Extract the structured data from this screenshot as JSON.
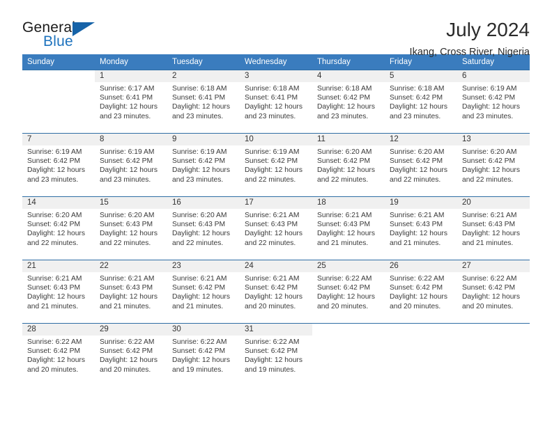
{
  "brand": {
    "name_part1": "General",
    "name_part2": "Blue",
    "logo_icon": "triangle-logo-icon"
  },
  "header": {
    "month_title": "July 2024",
    "location": "Ikang, Cross River, Nigeria"
  },
  "calendar": {
    "weekday_headers": [
      "Sunday",
      "Monday",
      "Tuesday",
      "Wednesday",
      "Thursday",
      "Friday",
      "Saturday"
    ],
    "accent_color": "#3a7cbe",
    "border_color": "#2e6da4",
    "daynum_bg": "#f0f0f0",
    "weeks": [
      [
        {
          "day": "",
          "blank": true,
          "lines": []
        },
        {
          "day": "1",
          "lines": [
            "Sunrise: 6:17 AM",
            "Sunset: 6:41 PM",
            "Daylight: 12 hours",
            "and 23 minutes."
          ]
        },
        {
          "day": "2",
          "lines": [
            "Sunrise: 6:18 AM",
            "Sunset: 6:41 PM",
            "Daylight: 12 hours",
            "and 23 minutes."
          ]
        },
        {
          "day": "3",
          "lines": [
            "Sunrise: 6:18 AM",
            "Sunset: 6:41 PM",
            "Daylight: 12 hours",
            "and 23 minutes."
          ]
        },
        {
          "day": "4",
          "lines": [
            "Sunrise: 6:18 AM",
            "Sunset: 6:42 PM",
            "Daylight: 12 hours",
            "and 23 minutes."
          ]
        },
        {
          "day": "5",
          "lines": [
            "Sunrise: 6:18 AM",
            "Sunset: 6:42 PM",
            "Daylight: 12 hours",
            "and 23 minutes."
          ]
        },
        {
          "day": "6",
          "lines": [
            "Sunrise: 6:19 AM",
            "Sunset: 6:42 PM",
            "Daylight: 12 hours",
            "and 23 minutes."
          ]
        }
      ],
      [
        {
          "day": "7",
          "lines": [
            "Sunrise: 6:19 AM",
            "Sunset: 6:42 PM",
            "Daylight: 12 hours",
            "and 23 minutes."
          ]
        },
        {
          "day": "8",
          "lines": [
            "Sunrise: 6:19 AM",
            "Sunset: 6:42 PM",
            "Daylight: 12 hours",
            "and 23 minutes."
          ]
        },
        {
          "day": "9",
          "lines": [
            "Sunrise: 6:19 AM",
            "Sunset: 6:42 PM",
            "Daylight: 12 hours",
            "and 23 minutes."
          ]
        },
        {
          "day": "10",
          "lines": [
            "Sunrise: 6:19 AM",
            "Sunset: 6:42 PM",
            "Daylight: 12 hours",
            "and 22 minutes."
          ]
        },
        {
          "day": "11",
          "lines": [
            "Sunrise: 6:20 AM",
            "Sunset: 6:42 PM",
            "Daylight: 12 hours",
            "and 22 minutes."
          ]
        },
        {
          "day": "12",
          "lines": [
            "Sunrise: 6:20 AM",
            "Sunset: 6:42 PM",
            "Daylight: 12 hours",
            "and 22 minutes."
          ]
        },
        {
          "day": "13",
          "lines": [
            "Sunrise: 6:20 AM",
            "Sunset: 6:42 PM",
            "Daylight: 12 hours",
            "and 22 minutes."
          ]
        }
      ],
      [
        {
          "day": "14",
          "lines": [
            "Sunrise: 6:20 AM",
            "Sunset: 6:42 PM",
            "Daylight: 12 hours",
            "and 22 minutes."
          ]
        },
        {
          "day": "15",
          "lines": [
            "Sunrise: 6:20 AM",
            "Sunset: 6:43 PM",
            "Daylight: 12 hours",
            "and 22 minutes."
          ]
        },
        {
          "day": "16",
          "lines": [
            "Sunrise: 6:20 AM",
            "Sunset: 6:43 PM",
            "Daylight: 12 hours",
            "and 22 minutes."
          ]
        },
        {
          "day": "17",
          "lines": [
            "Sunrise: 6:21 AM",
            "Sunset: 6:43 PM",
            "Daylight: 12 hours",
            "and 22 minutes."
          ]
        },
        {
          "day": "18",
          "lines": [
            "Sunrise: 6:21 AM",
            "Sunset: 6:43 PM",
            "Daylight: 12 hours",
            "and 21 minutes."
          ]
        },
        {
          "day": "19",
          "lines": [
            "Sunrise: 6:21 AM",
            "Sunset: 6:43 PM",
            "Daylight: 12 hours",
            "and 21 minutes."
          ]
        },
        {
          "day": "20",
          "lines": [
            "Sunrise: 6:21 AM",
            "Sunset: 6:43 PM",
            "Daylight: 12 hours",
            "and 21 minutes."
          ]
        }
      ],
      [
        {
          "day": "21",
          "lines": [
            "Sunrise: 6:21 AM",
            "Sunset: 6:43 PM",
            "Daylight: 12 hours",
            "and 21 minutes."
          ]
        },
        {
          "day": "22",
          "lines": [
            "Sunrise: 6:21 AM",
            "Sunset: 6:43 PM",
            "Daylight: 12 hours",
            "and 21 minutes."
          ]
        },
        {
          "day": "23",
          "lines": [
            "Sunrise: 6:21 AM",
            "Sunset: 6:42 PM",
            "Daylight: 12 hours",
            "and 21 minutes."
          ]
        },
        {
          "day": "24",
          "lines": [
            "Sunrise: 6:21 AM",
            "Sunset: 6:42 PM",
            "Daylight: 12 hours",
            "and 20 minutes."
          ]
        },
        {
          "day": "25",
          "lines": [
            "Sunrise: 6:22 AM",
            "Sunset: 6:42 PM",
            "Daylight: 12 hours",
            "and 20 minutes."
          ]
        },
        {
          "day": "26",
          "lines": [
            "Sunrise: 6:22 AM",
            "Sunset: 6:42 PM",
            "Daylight: 12 hours",
            "and 20 minutes."
          ]
        },
        {
          "day": "27",
          "lines": [
            "Sunrise: 6:22 AM",
            "Sunset: 6:42 PM",
            "Daylight: 12 hours",
            "and 20 minutes."
          ]
        }
      ],
      [
        {
          "day": "28",
          "lines": [
            "Sunrise: 6:22 AM",
            "Sunset: 6:42 PM",
            "Daylight: 12 hours",
            "and 20 minutes."
          ]
        },
        {
          "day": "29",
          "lines": [
            "Sunrise: 6:22 AM",
            "Sunset: 6:42 PM",
            "Daylight: 12 hours",
            "and 20 minutes."
          ]
        },
        {
          "day": "30",
          "lines": [
            "Sunrise: 6:22 AM",
            "Sunset: 6:42 PM",
            "Daylight: 12 hours",
            "and 19 minutes."
          ]
        },
        {
          "day": "31",
          "lines": [
            "Sunrise: 6:22 AM",
            "Sunset: 6:42 PM",
            "Daylight: 12 hours",
            "and 19 minutes."
          ]
        },
        {
          "day": "",
          "blank": true,
          "lines": []
        },
        {
          "day": "",
          "blank": true,
          "lines": []
        },
        {
          "day": "",
          "blank": true,
          "lines": []
        }
      ]
    ]
  }
}
